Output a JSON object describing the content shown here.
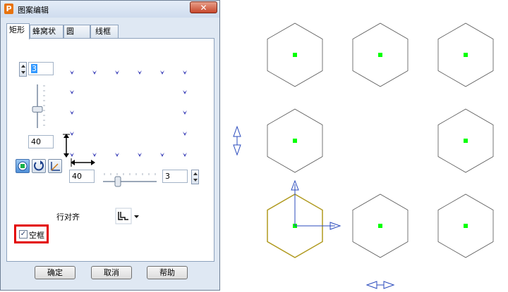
{
  "dialog": {
    "title": "图案编辑",
    "app_icon_letter": "P",
    "close_label": "✕"
  },
  "tabs": [
    {
      "label": "矩形",
      "active": true
    },
    {
      "label": "蜂窝状",
      "active": false
    },
    {
      "label": "圆",
      "active": false
    },
    {
      "label": "线框",
      "active": false
    }
  ],
  "rect_panel": {
    "rows_value": "3",
    "row_spacing_value": "40",
    "col_spacing_value": "40",
    "cols_value": "3",
    "vertical_slider_level": 0.42,
    "horizontal_slider_level": 0.25,
    "row_align_label": "行对齐",
    "hollow_frame_label": "空框",
    "hollow_frame_checked": true
  },
  "buttons": {
    "ok": "确定",
    "cancel": "取消",
    "help": "帮助"
  },
  "colors": {
    "marker": "#3a3fb8",
    "hex_normal": "#555555",
    "hex_selected": "#b09a1f",
    "center_dot": "#00ff00",
    "axis": "#2b4bbd",
    "highlight": "#e30000"
  },
  "icons": {
    "mode_square": "square-target-icon",
    "mode_rotate": "rotate-icon",
    "mode_axes": "axes-icon",
    "row_align_dropdown": "align-bottom-icon",
    "vertical_resize": "vertical-double-arrow-icon",
    "horizontal_resize": "horizontal-double-arrow-icon"
  }
}
